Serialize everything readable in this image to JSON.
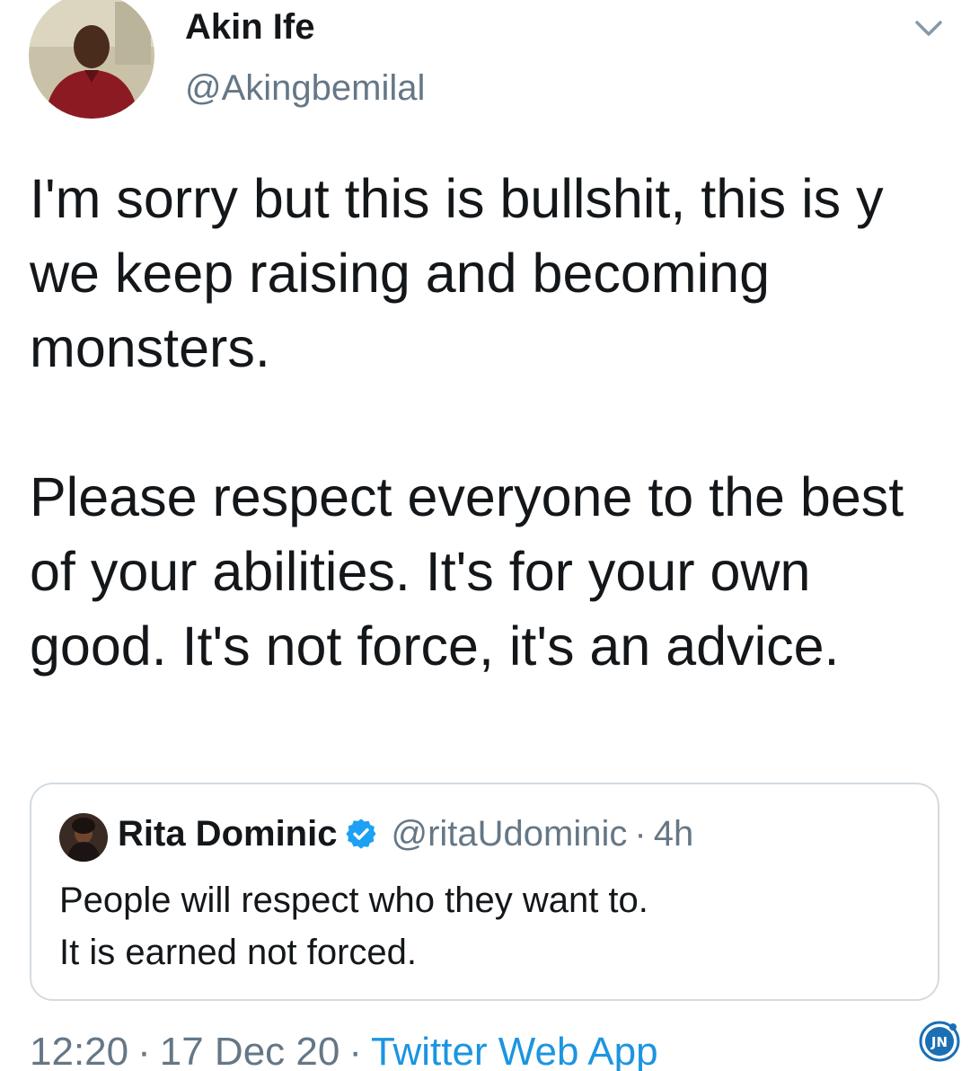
{
  "tweet": {
    "author": {
      "name": "Akin Ife",
      "handle": "@Akingbemilal"
    },
    "paragraphs": [
      "I'm sorry but this is bullshit, this is y we keep raising and becoming monsters.",
      "Please respect everyone to the best of your abilities. It's for your own good. It's not force, it's an advice."
    ],
    "quoted": {
      "name": "Rita Dominic",
      "verified_icon": "verified-badge-icon",
      "handle": "@ritaUdominic",
      "separator": "·",
      "time": "4h",
      "lines": [
        "People will respect who they want to.",
        "It is earned not forced."
      ]
    },
    "footer": {
      "time": "12:20",
      "date": "17 Dec 20",
      "separator": "·",
      "source": "Twitter Web App"
    }
  },
  "watermark": {
    "text": "JN"
  },
  "colors": {
    "text": "#14171a",
    "secondary": "#657786",
    "link": "#1b95e0",
    "border": "#d4dbe1",
    "verified": "#1da1f2"
  }
}
